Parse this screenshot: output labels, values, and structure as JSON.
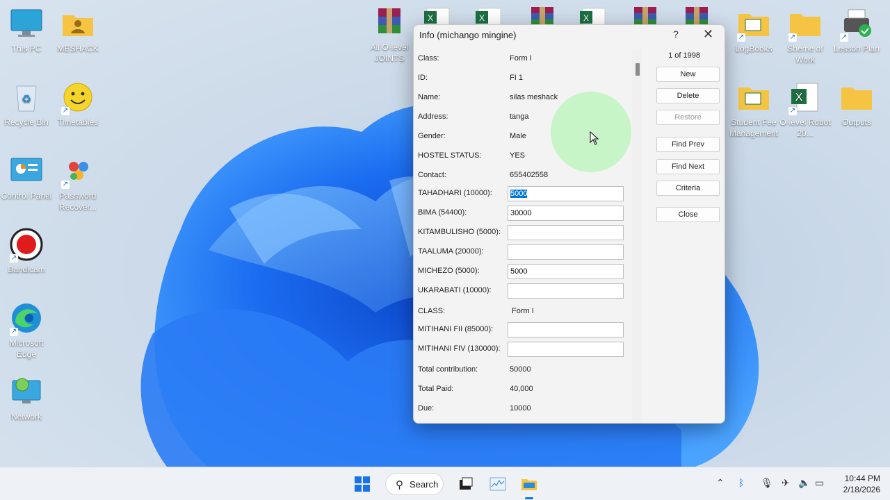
{
  "desktop": {
    "icons_left": [
      {
        "label": "This PC"
      },
      {
        "label": "MESHACK"
      },
      {
        "label": "Recycle Bin"
      },
      {
        "label": "Timetables"
      },
      {
        "label": "Control Panel"
      },
      {
        "label": "Password Recover..."
      },
      {
        "label": "Bandicam"
      },
      {
        "label": "Microsoft Edge"
      },
      {
        "label": "Network"
      }
    ],
    "icons_top": [
      {
        "label": "All O-level JOINTS"
      }
    ],
    "icons_right": [
      {
        "label": "LogBooks"
      },
      {
        "label": "Sheme of Work"
      },
      {
        "label": "Lesson Plan"
      },
      {
        "label": "Student Fee Management"
      },
      {
        "label": "O-level Robot 20..."
      },
      {
        "label": "Outputs"
      }
    ]
  },
  "dialog": {
    "title": "Info (michango mingine)",
    "help": "?",
    "close": "✕",
    "record_position": "1 of 1998",
    "fields": [
      {
        "label": "Class:",
        "value": "Form I",
        "type": "text"
      },
      {
        "label": "ID:",
        "value": "FI 1",
        "type": "text"
      },
      {
        "label": "Name:",
        "value": "silas meshack",
        "type": "text"
      },
      {
        "label": "Address:",
        "value": "tanga",
        "type": "text"
      },
      {
        "label": "Gender:",
        "value": "Male",
        "type": "text"
      },
      {
        "label": "HOSTEL STATUS:",
        "value": "YES",
        "type": "text"
      },
      {
        "label": "Contact:",
        "value": "655402558",
        "type": "text"
      },
      {
        "label": "TAHADHARI (10000):",
        "value": "5000",
        "type": "input"
      },
      {
        "label": "BIMA (54400):",
        "value": "30000",
        "type": "input"
      },
      {
        "label": "KITAMBULISHO (5000):",
        "value": "",
        "type": "input"
      },
      {
        "label": "TAALUMA (20000):",
        "value": "",
        "type": "input"
      },
      {
        "label": "MICHEZO (5000):",
        "value": "5000",
        "type": "input"
      },
      {
        "label": "UKARABATI (10000):",
        "value": "",
        "type": "input"
      },
      {
        "label": "CLASS:",
        "value": "Form I",
        "type": "text"
      },
      {
        "label": "MITIHANI FII (85000):",
        "value": "",
        "type": "input"
      },
      {
        "label": "MITIHANI FIV (130000):",
        "value": "",
        "type": "input"
      },
      {
        "label": "Total contribution:",
        "value": "50000",
        "type": "text"
      },
      {
        "label": "Total Paid:",
        "value": "40,000",
        "type": "text"
      },
      {
        "label": "Due:",
        "value": "10000",
        "type": "text"
      }
    ],
    "buttons": {
      "new": "New",
      "delete": "Delete",
      "restore": "Restore",
      "find_prev": "Find Prev",
      "find_next": "Find Next",
      "criteria": "Criteria",
      "close": "Close"
    }
  },
  "taskbar": {
    "search_label": "Search",
    "time": "10:44 PM",
    "date": "2/18/2026"
  }
}
